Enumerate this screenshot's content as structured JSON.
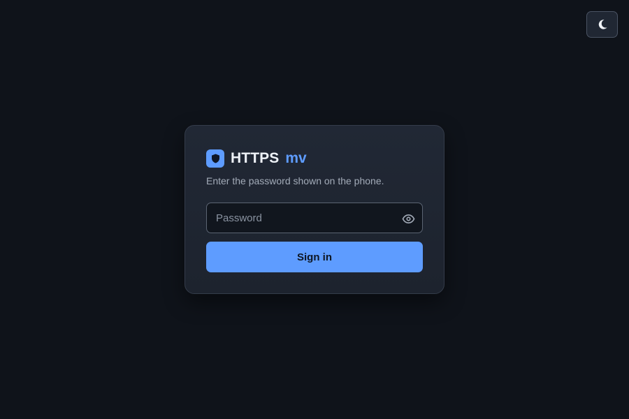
{
  "theme_toggle": {
    "icon": "moon-icon"
  },
  "login_card": {
    "brand": {
      "logo_icon": "shield-icon",
      "name": "HTTPS",
      "suffix": "mv"
    },
    "subtitle": "Enter the password shown on the phone.",
    "password_field": {
      "value": "",
      "placeholder": "Password",
      "toggle_icon": "eye-icon"
    },
    "signin_button": {
      "label": "Sign in"
    }
  },
  "colors": {
    "background": "#0f131a",
    "card": "#212835",
    "accent": "#5e9cff",
    "text_primary": "#eef2f7",
    "text_secondary": "#a3abb8"
  }
}
